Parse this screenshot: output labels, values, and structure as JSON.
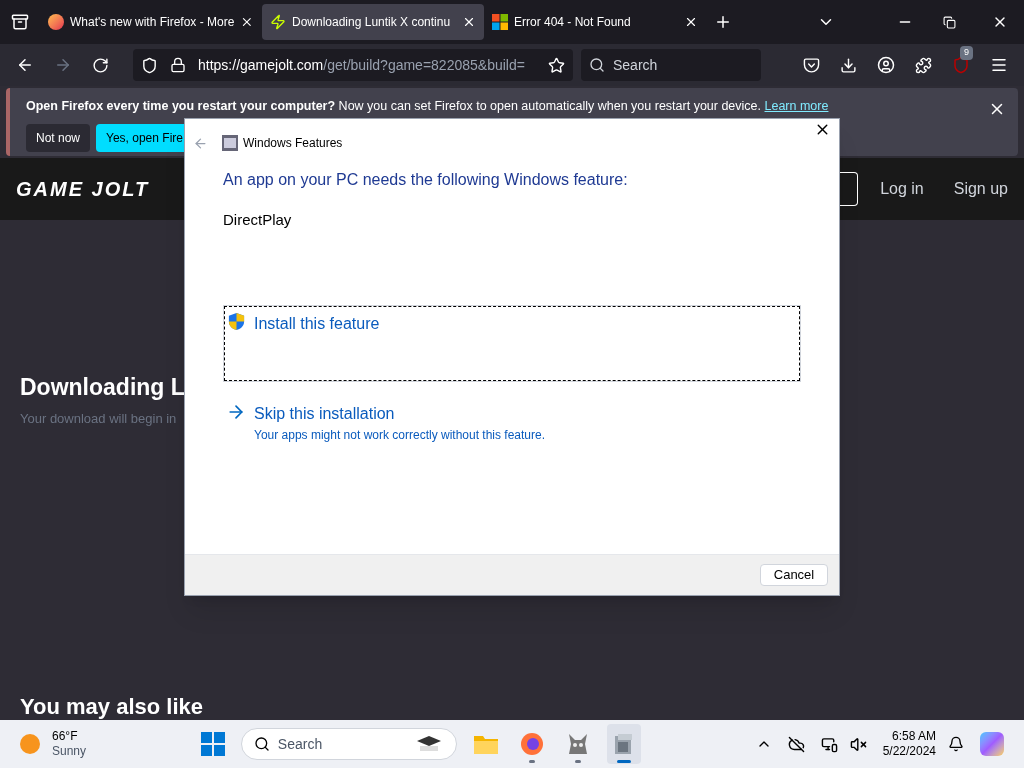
{
  "tabs": [
    {
      "title": "What's new with Firefox - More",
      "selected": false,
      "kind": "firefox"
    },
    {
      "title": "Downloading Luntik X continu",
      "selected": true,
      "kind": "bolt"
    },
    {
      "title": "Error 404 - Not Found",
      "selected": false,
      "kind": "windows"
    }
  ],
  "address_bar": {
    "url_host": "https://gamejolt.com",
    "url_path": "/get/build?game=822085&build="
  },
  "search": {
    "placeholder": "Search"
  },
  "extension_badge": "9",
  "notification": {
    "text": "**Open Firefox every time you restart your computer?** Now you can set Firefox to open automatically when you restart your device.",
    "link": "Learn more",
    "buttons": [
      "Not now",
      "Yes, open Fire"
    ]
  },
  "site": {
    "logo": "GAME JOLT",
    "nav": [
      "Log in",
      "Sign up"
    ],
    "heading": "Downloading L",
    "subtext": "Your download will begin in",
    "section": "You may also like"
  },
  "dialog": {
    "title": "Windows Features",
    "question": "An app on your PC needs the following Windows feature:",
    "feature": "DirectPlay",
    "options": [
      {
        "kind": "install",
        "label": "Install this feature",
        "focused": true
      },
      {
        "kind": "skip",
        "label": "Skip this installation",
        "note": "Your apps might not work correctly without this feature.",
        "focused": false
      }
    ],
    "cancel": "Cancel"
  },
  "taskbar": {
    "temperature": "66°F",
    "weather": "Sunny",
    "search": "Search",
    "apps": [
      {
        "kind": "folder",
        "running": false,
        "active": false
      },
      {
        "kind": "firefox",
        "running": true,
        "active": false
      },
      {
        "kind": "creature",
        "running": true,
        "active": false
      },
      {
        "kind": "installer",
        "running": true,
        "active": true
      }
    ],
    "time": "6:58 AM",
    "date": "5/22/2024"
  }
}
